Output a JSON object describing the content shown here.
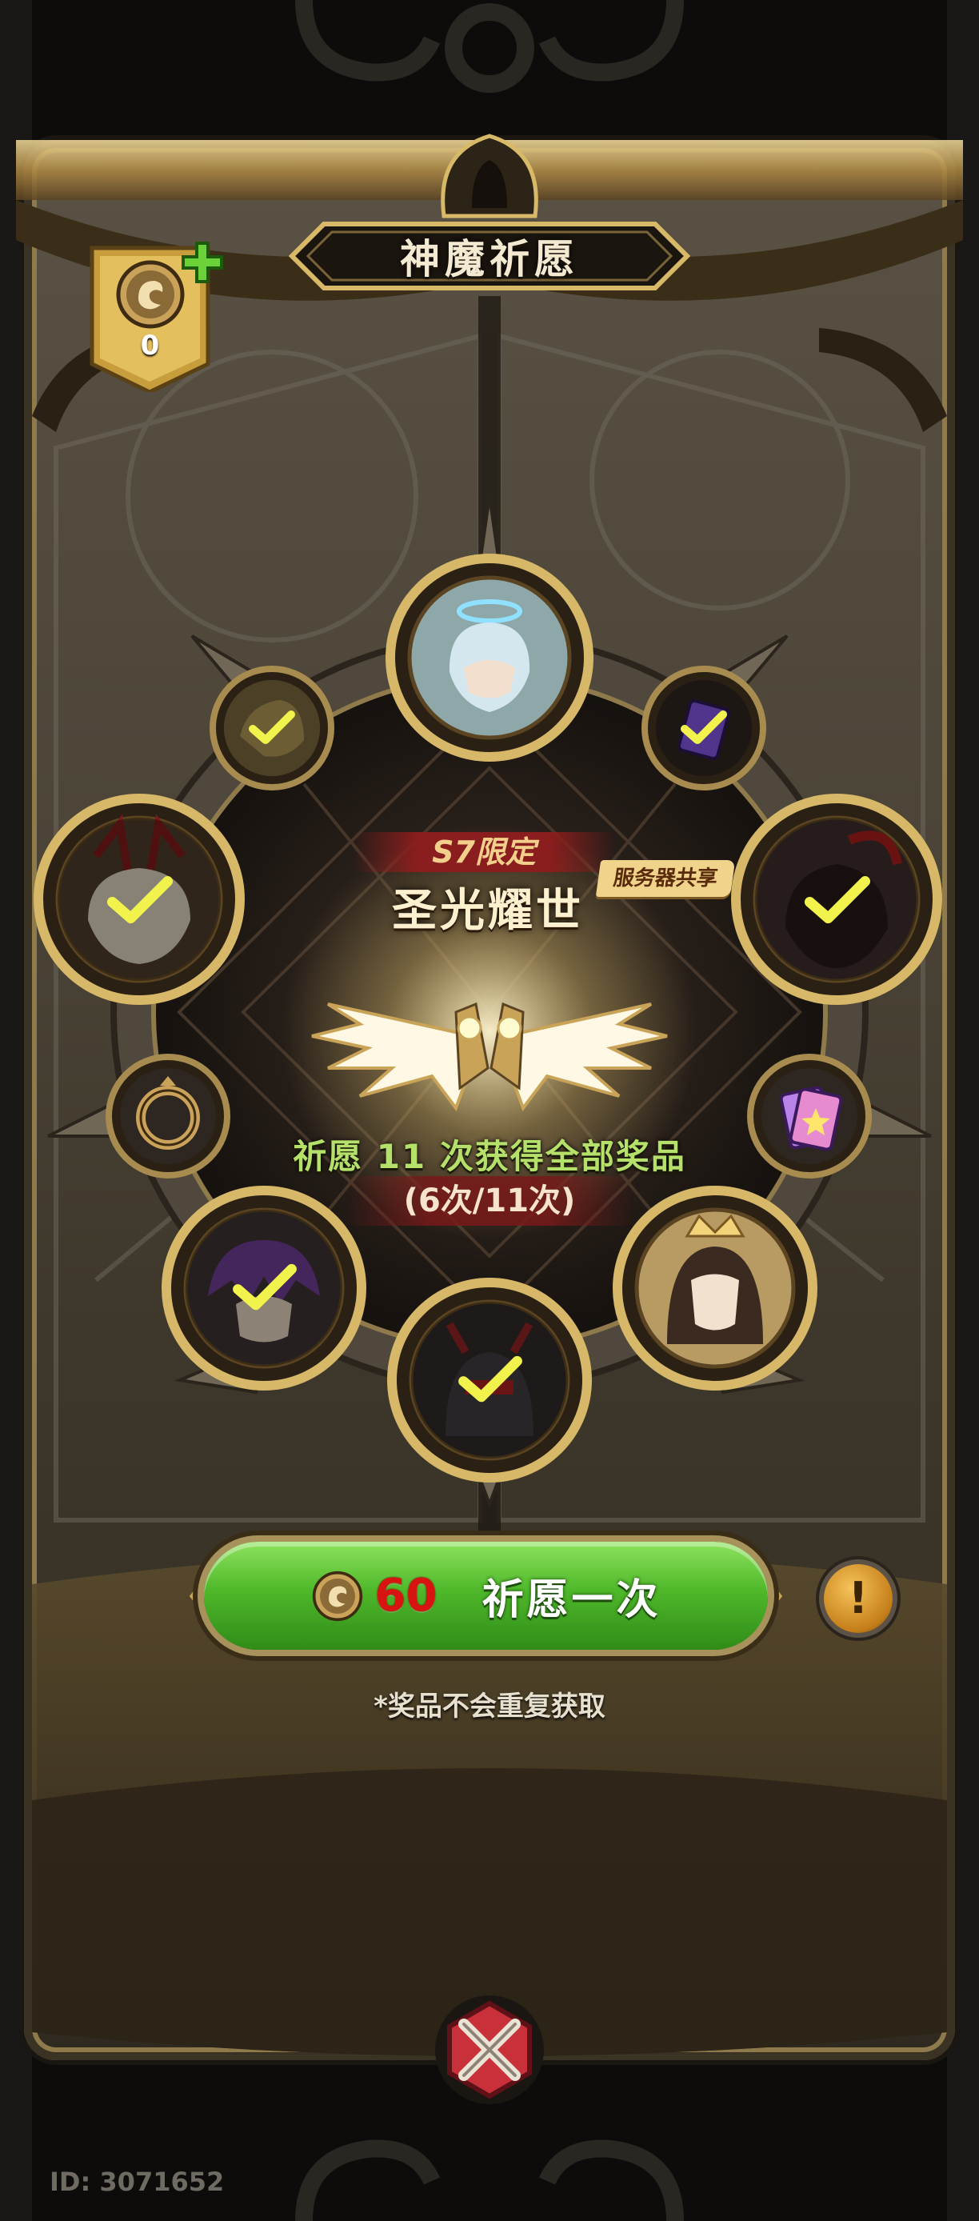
{
  "title": "神魔祈愿",
  "currency": {
    "count": "0",
    "icon": "soul-coin-icon",
    "add_icon": "plus-icon"
  },
  "banner": {
    "limited_tag": "S7限定",
    "name": "圣光耀世",
    "shared_badge": "服务器共享",
    "featured_reward_icon": "holy-wings-icon"
  },
  "progress": {
    "summary": "祈愿 11 次获得全部奖品",
    "count": "(6次/11次)",
    "done": 6,
    "total": 11
  },
  "rewards": [
    {
      "icon": "haloed-hero-portrait",
      "claimed": false
    },
    {
      "icon": "hero-portrait",
      "claimed": true
    },
    {
      "icon": "purple-card-icon",
      "claimed": true
    },
    {
      "icon": "horned-hero-portrait",
      "claimed": true
    },
    {
      "icon": "dark-demon-portrait",
      "claimed": true
    },
    {
      "icon": "ring-icon",
      "claimed": false
    },
    {
      "icon": "card-pack-icon",
      "claimed": false
    },
    {
      "icon": "purple-hair-hero-portrait",
      "claimed": true
    },
    {
      "icon": "golden-crown-hero-portrait",
      "claimed": false
    },
    {
      "icon": "armored-knight-portrait",
      "claimed": true
    }
  ],
  "pray_button": {
    "cost": "60",
    "label": "祈愿一次"
  },
  "info_button": {
    "label": "!"
  },
  "note": "*奖品不会重复获取",
  "player_id": "ID: 3071652",
  "colors": {
    "accent_gold": "#c9a458",
    "button_green": "#4fb82a",
    "cost_red": "#d7140f",
    "progress_green": "#b5e06a"
  }
}
